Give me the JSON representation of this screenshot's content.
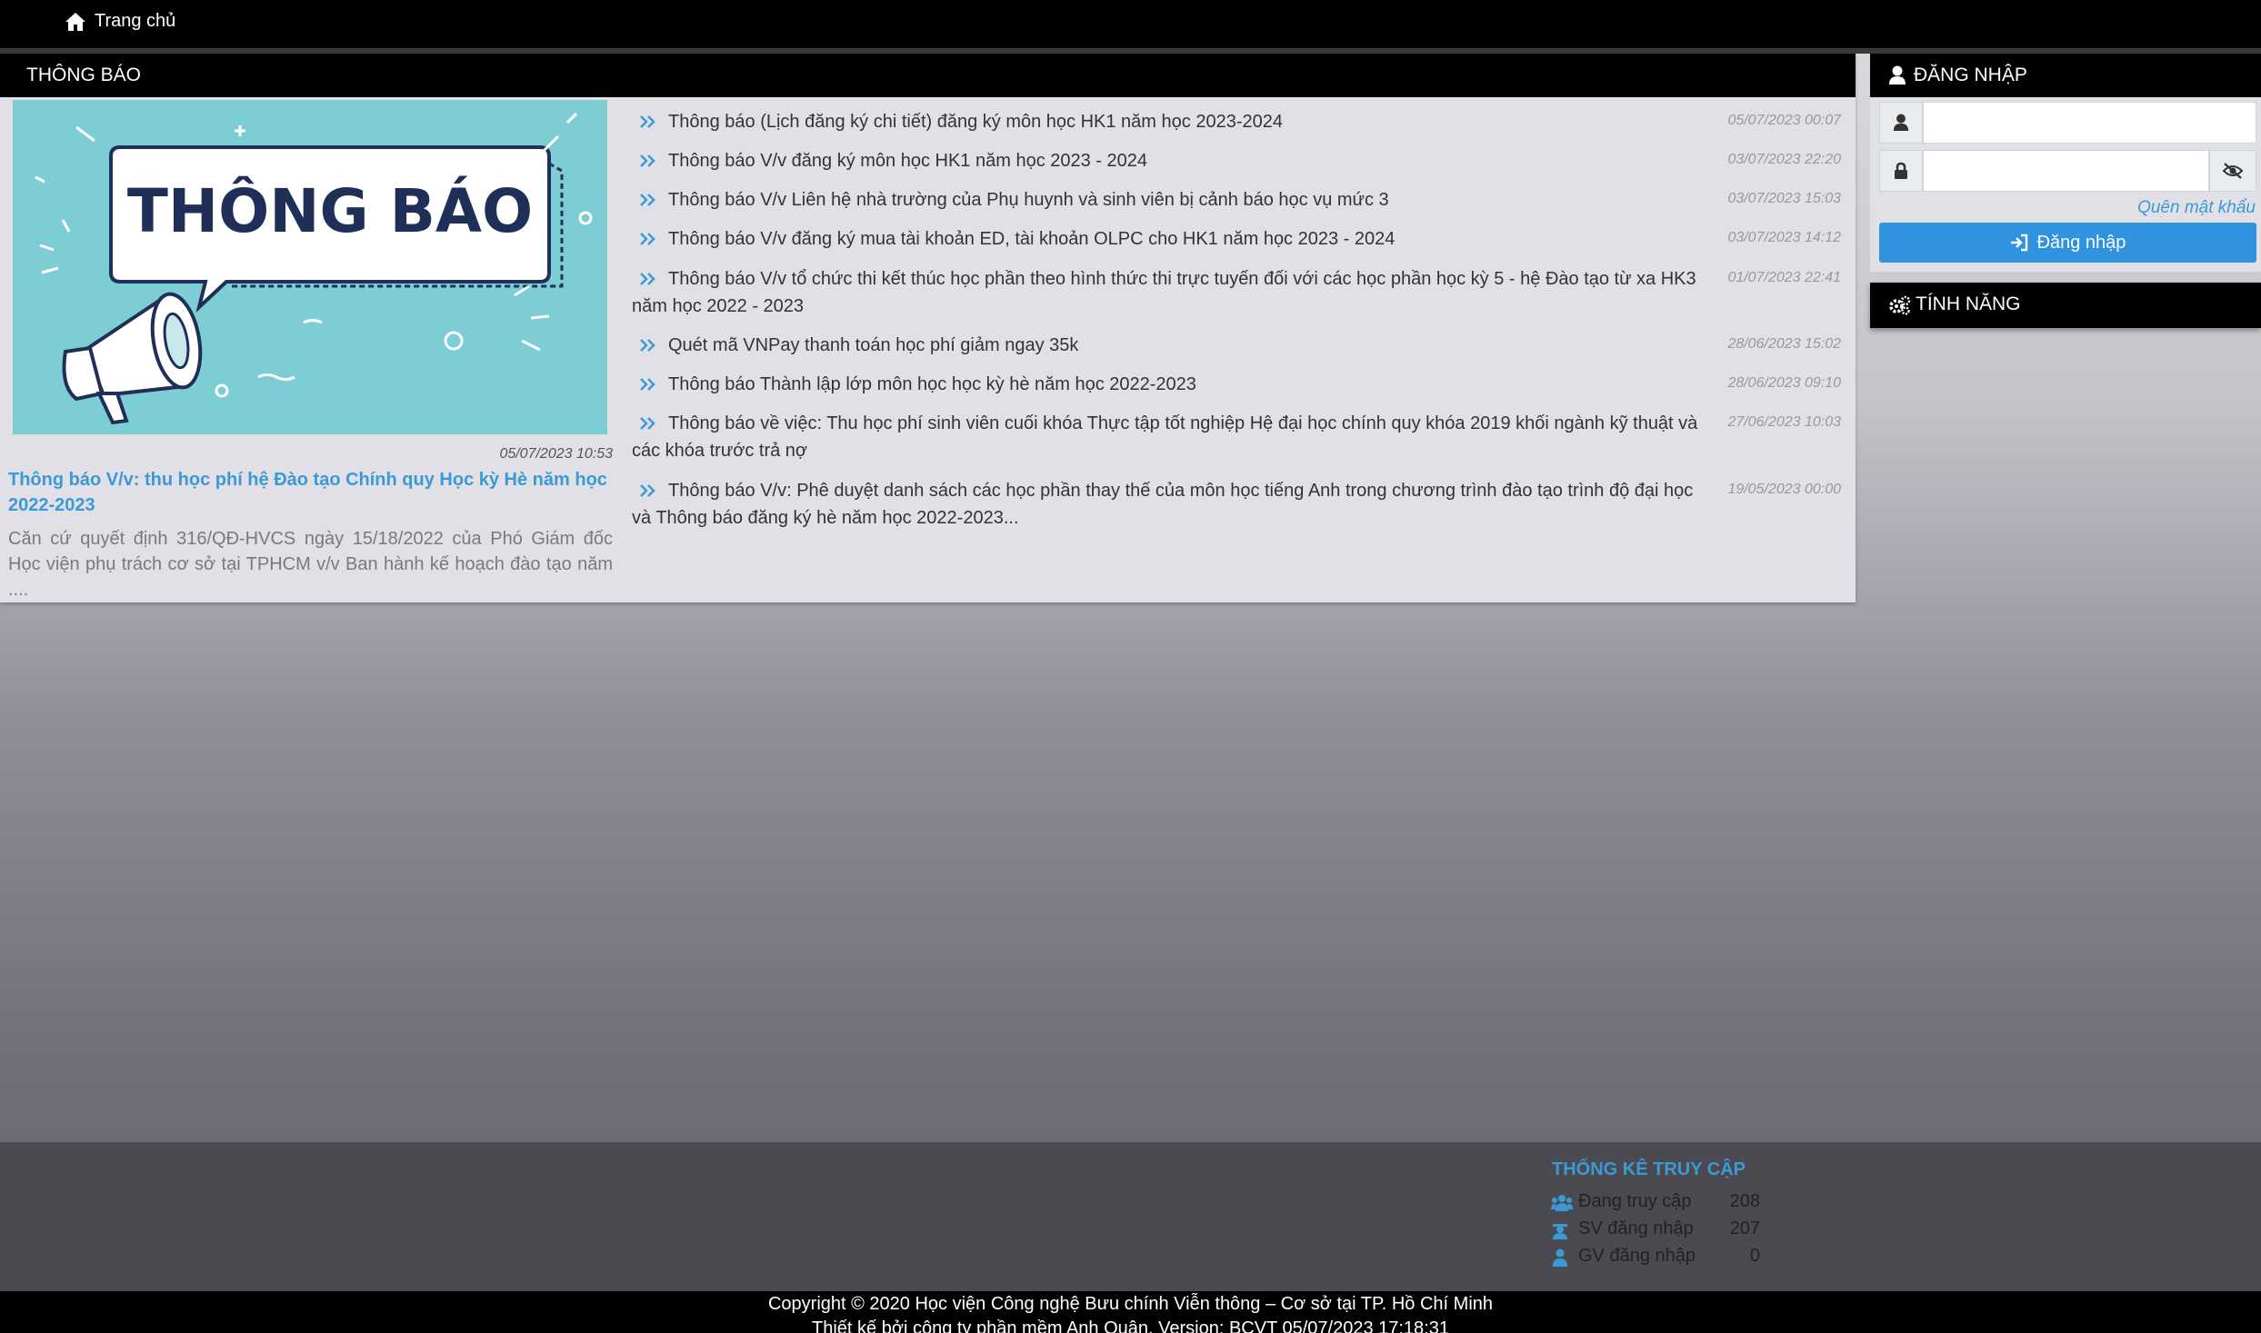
{
  "nav": {
    "home_label": "Trang chủ"
  },
  "announcements": {
    "header": "THÔNG BÁO",
    "featured": {
      "image_text": "THÔNG BÁO",
      "date": "05/07/2023 10:53",
      "title": "Thông báo V/v: thu học phí hệ Đào tạo Chính quy Học kỳ Hè năm học 2022-2023",
      "excerpt": "Căn cứ quyết định 316/QĐ-HVCS ngày 15/18/2022 của Phó Giám đốc Học viện phụ trách cơ sở tại TPHCM v/v Ban hành kế hoạch đào tạo năm ...."
    },
    "items": [
      {
        "text": "Thông báo (Lịch đăng ký chi tiết) đăng ký môn học HK1 năm học 2023-2024",
        "date": "05/07/2023 00:07"
      },
      {
        "text": "Thông báo V/v đăng ký môn học HK1 năm học 2023 - 2024",
        "date": "03/07/2023 22:20"
      },
      {
        "text": "Thông báo V/v Liên hệ nhà trường của Phụ huynh và sinh viên bị cảnh báo học vụ mức 3",
        "date": "03/07/2023 15:03"
      },
      {
        "text": "Thông báo V/v đăng ký mua tài khoản ED, tài khoản OLPC cho HK1 năm học 2023 - 2024",
        "date": "03/07/2023 14:12"
      },
      {
        "text": "Thông báo V/v tổ chức thi kết thúc học phần theo hình thức thi trực tuyến đối với các học phần học kỳ 5 - hệ Đào tạo từ xa HK3 năm học 2022 - 2023",
        "date": "01/07/2023 22:41"
      },
      {
        "text": "Quét mã VNPay thanh toán học phí giảm ngay 35k",
        "date": "28/06/2023 15:02"
      },
      {
        "text": "Thông báo Thành lập lớp môn học học kỳ hè năm học 2022-2023",
        "date": "28/06/2023 09:10"
      },
      {
        "text": "Thông báo về việc: Thu học phí sinh viên cuối khóa Thực tập tốt nghiệp Hệ đại học chính quy khóa 2019 khối ngành kỹ thuật và các khóa trước trả nợ",
        "date": "27/06/2023 10:03"
      },
      {
        "text": "Thông báo V/v: Phê duyệt danh sách các học phần thay thế của môn học tiếng Anh trong chương trình đào tạo trình độ đại học và Thông báo đăng ký hè năm học 2022-2023...",
        "date": "19/05/2023 00:00"
      }
    ]
  },
  "login": {
    "header": "ĐĂNG NHẬP",
    "username_value": "",
    "password_value": "",
    "forgot_label": "Quên mật khẩu",
    "submit_label": "Đăng nhập"
  },
  "features": {
    "header": "TÍNH NĂNG"
  },
  "stats": {
    "title": "THỐNG KÊ TRUY CẬP",
    "rows": [
      {
        "label": "Đang truy cập",
        "value": "208"
      },
      {
        "label": "SV đăng nhập",
        "value": "207"
      },
      {
        "label": "GV đăng nhập",
        "value": "0"
      }
    ]
  },
  "footer": {
    "copyright": "Copyright © 2020 Học viện Công nghệ Bưu chính Viễn thông – Cơ sở tại TP. Hồ Chí Minh",
    "credits": "Thiết kế bởi công ty phần mềm Anh Quân. Version: BCVT 05/07/2023 17:18:31"
  },
  "colors": {
    "accent": "#3b9ad5",
    "button": "#2f93e0",
    "bar": "#000000",
    "panel": "#e1e0e6"
  },
  "icons": {
    "home": "home-icon",
    "user": "user-icon",
    "lock": "lock-icon",
    "eye": "eye-slash-icon",
    "login": "sign-in-icon",
    "gears": "cogs-icon",
    "chevron": "double-chevron-right-icon",
    "users": "users-icon",
    "student": "student-icon",
    "teacher": "teacher-icon"
  }
}
